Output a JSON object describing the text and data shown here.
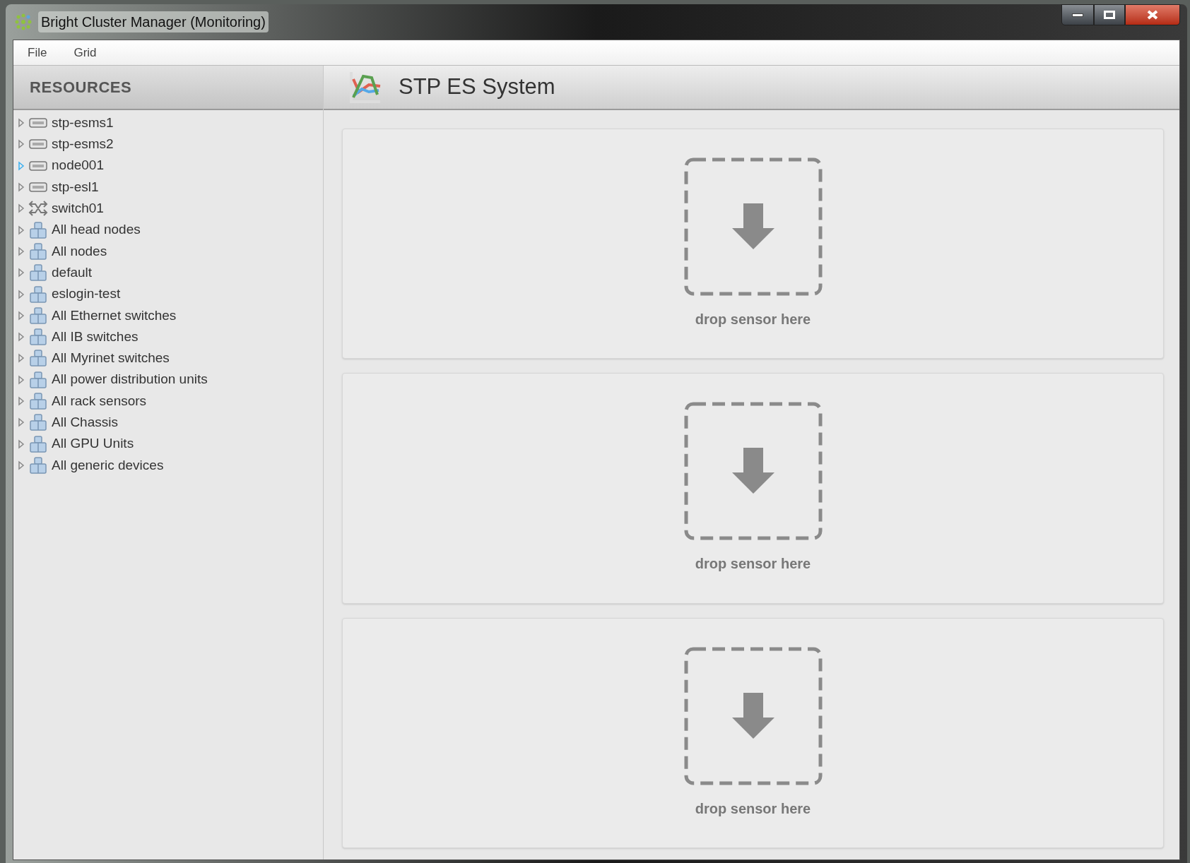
{
  "window": {
    "title": "Bright Cluster Manager (Monitoring)"
  },
  "menu": [
    {
      "label": "File"
    },
    {
      "label": "Grid"
    }
  ],
  "sidebar": {
    "title": "RESOURCES",
    "items": [
      {
        "label": "stp-esms1",
        "kind": "host",
        "hovered": false
      },
      {
        "label": "stp-esms2",
        "kind": "host",
        "hovered": false
      },
      {
        "label": "node001",
        "kind": "host",
        "hovered": true
      },
      {
        "label": "stp-esl1",
        "kind": "host",
        "hovered": false
      },
      {
        "label": "switch01",
        "kind": "switch",
        "hovered": false
      },
      {
        "label": "All head nodes",
        "kind": "group",
        "hovered": false
      },
      {
        "label": "All nodes",
        "kind": "group",
        "hovered": false
      },
      {
        "label": "default",
        "kind": "group",
        "hovered": false
      },
      {
        "label": "eslogin-test",
        "kind": "group",
        "hovered": false
      },
      {
        "label": "All Ethernet switches",
        "kind": "group",
        "hovered": false
      },
      {
        "label": "All IB switches",
        "kind": "group",
        "hovered": false
      },
      {
        "label": "All Myrinet switches",
        "kind": "group",
        "hovered": false
      },
      {
        "label": "All power distribution units",
        "kind": "group",
        "hovered": false
      },
      {
        "label": "All rack sensors",
        "kind": "group",
        "hovered": false
      },
      {
        "label": "All Chassis",
        "kind": "group",
        "hovered": false
      },
      {
        "label": "All GPU Units",
        "kind": "group",
        "hovered": false
      },
      {
        "label": "All generic devices",
        "kind": "group",
        "hovered": false
      }
    ]
  },
  "main": {
    "title": "STP ES System",
    "drop_zones": [
      {
        "label": "drop sensor here"
      },
      {
        "label": "drop sensor here"
      },
      {
        "label": "drop sensor here"
      }
    ]
  }
}
